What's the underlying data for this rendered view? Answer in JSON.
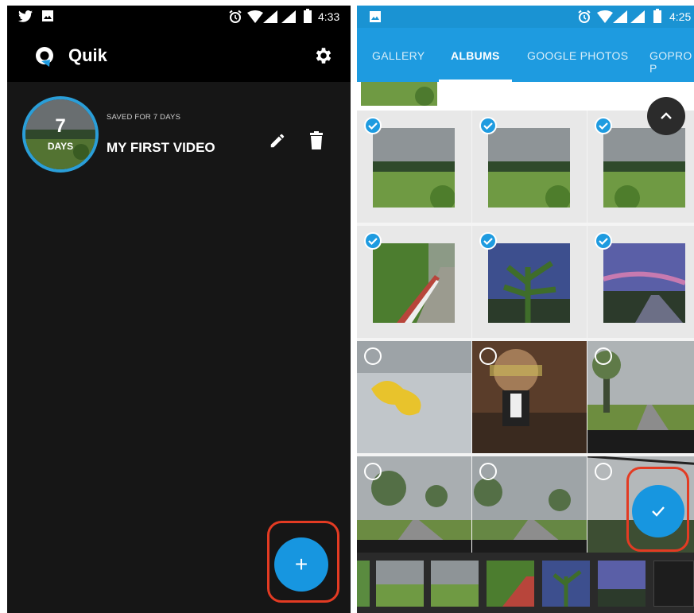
{
  "left": {
    "status": {
      "time": "4:33"
    },
    "app": {
      "title": "Quik"
    },
    "video": {
      "days_number": "7",
      "days_label": "DAYS",
      "saved_text": "SAVED FOR 7 DAYS",
      "title": "MY FIRST VIDEO"
    },
    "fab": {
      "label": "+"
    }
  },
  "right": {
    "status": {
      "time": "4:25"
    },
    "tabs": [
      {
        "label": "GALLERY"
      },
      {
        "label": "ALBUMS"
      },
      {
        "label": "GOOGLE PHOTOS"
      },
      {
        "label": "GOPRO P"
      }
    ],
    "grid_selected": [
      true,
      true,
      true,
      true,
      true,
      true,
      false,
      false,
      false,
      false,
      false,
      false
    ]
  },
  "colors": {
    "accent": "#1e9be0",
    "highlight_ring": "#e33b23",
    "dark_bg": "#161616"
  },
  "icons": [
    "twitter-icon",
    "image-icon",
    "alarm-icon",
    "wifi-icon",
    "signal-icon",
    "battery-icon",
    "settings-icon",
    "pencil-icon",
    "trash-icon",
    "plus-icon",
    "chevron-up-icon",
    "check-icon"
  ]
}
